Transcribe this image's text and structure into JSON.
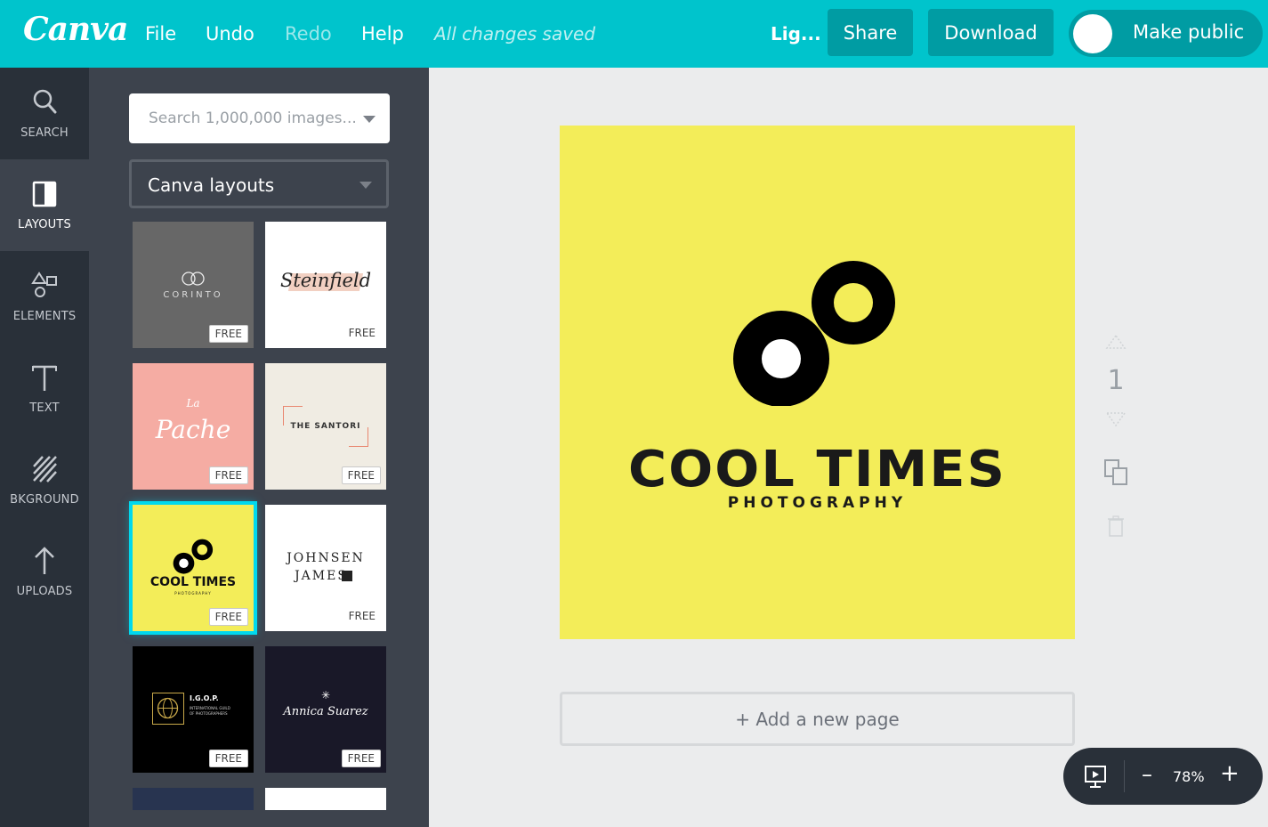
{
  "topbar": {
    "logo": "Canva",
    "menu": {
      "file": "File",
      "undo": "Undo",
      "redo": "Redo",
      "help": "Help"
    },
    "status": "All changes saved",
    "doc_name": "Lig...",
    "share": "Share",
    "download": "Download",
    "make_public": "Make public",
    "make_public_on": false
  },
  "rail": [
    {
      "label": "SEARCH",
      "icon": "search-icon"
    },
    {
      "label": "LAYOUTS",
      "icon": "layouts-icon"
    },
    {
      "label": "ELEMENTS",
      "icon": "elements-icon"
    },
    {
      "label": "TEXT",
      "icon": "text-icon"
    },
    {
      "label": "BKGROUND",
      "icon": "background-icon"
    },
    {
      "label": "UPLOADS",
      "icon": "upload-icon"
    }
  ],
  "panel": {
    "search_placeholder": "Search 1,000,000 images...",
    "layout_select": "Canva layouts",
    "free_badge": "FREE",
    "thumbs": [
      {
        "name": "CORINTO",
        "badge": "FREE"
      },
      {
        "name": "Steinfield",
        "badge": "FREE"
      },
      {
        "name": "Pache",
        "prefix": "La",
        "badge": "FREE"
      },
      {
        "name": "THE SANTORI",
        "badge": "FREE"
      },
      {
        "name": "COOL TIMES",
        "sub": "PHOTOGRAPHY",
        "badge": "FREE"
      },
      {
        "name_line1": "JOHNSEN",
        "name_line2": "JAMES",
        "badge": "FREE"
      },
      {
        "name": "I.G.O.P.",
        "sub": "INTERNATIONAL GUILD OF PHOTOGRAPHERS",
        "badge": "FREE"
      },
      {
        "name": "Annica Suarez",
        "badge": "FREE"
      }
    ]
  },
  "canvas": {
    "background": "#f3ed59",
    "title": "COOL TIMES",
    "subtitle": "PHOTOGRAPHY"
  },
  "add_page": "+ Add a new page",
  "page_number": "1",
  "zoom": "78%",
  "colors": {
    "brand": "#00c4cc",
    "rail": "#293039",
    "panel": "#3d434d",
    "canvas": "#ebeced"
  }
}
